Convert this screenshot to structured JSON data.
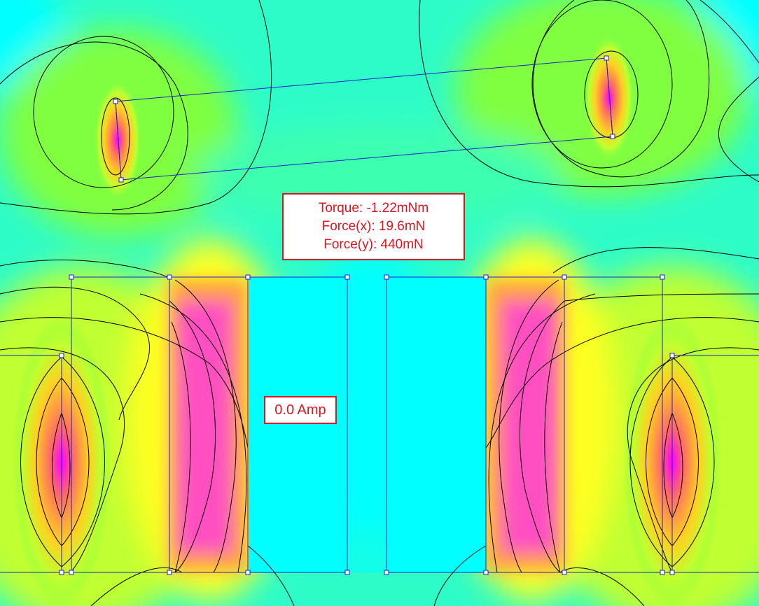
{
  "results": {
    "torque": "Torque: -1.22mNm",
    "force_x": "Force(x): 19.6mN",
    "force_y": "Force(y): 440mN"
  },
  "coil": {
    "current": "0.0 Amp"
  },
  "colors": {
    "background": "#2efcc8",
    "low_field": "#00ffff",
    "mid_field": "#80ff40",
    "field_yellow": "#ffff20",
    "field_orange": "#ffa040",
    "high_field": "#ff00ff",
    "geometry_lines": "#2020c8",
    "flux_lines": "#000000",
    "label_accent": "#e0141e"
  }
}
